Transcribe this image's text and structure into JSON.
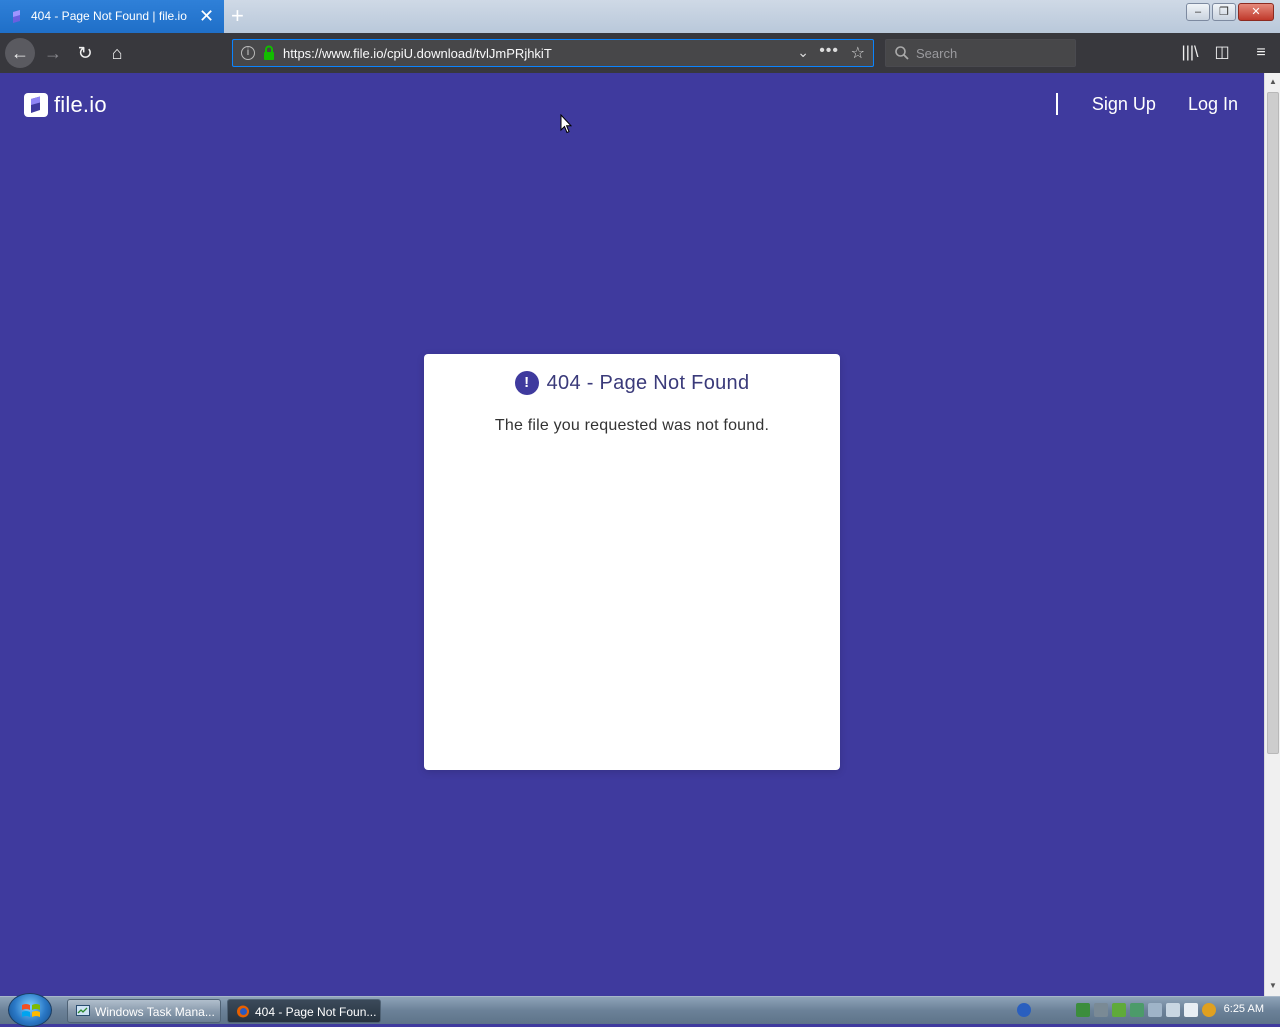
{
  "browser": {
    "tab_title": "404 - Page Not Found | file.io",
    "new_tab": "+",
    "url": "https://www.file.io/cpiU.download/tvlJmPRjhkiT",
    "search_placeholder": "Search",
    "accent_color": "#0a84ff"
  },
  "site": {
    "logo_text": "file.io",
    "nav": {
      "sign_up": "Sign Up",
      "log_in": "Log In"
    },
    "background_color": "#3f3a9e"
  },
  "error_card": {
    "icon": "exclamation-icon",
    "icon_glyph": "!",
    "heading": "404 - Page Not Found",
    "message": "The file you requested was not found."
  },
  "taskbar": {
    "items": [
      {
        "label": "Windows Task Mana..."
      },
      {
        "label": "404 - Page Not Foun..."
      }
    ],
    "clock": "6:25 AM"
  }
}
